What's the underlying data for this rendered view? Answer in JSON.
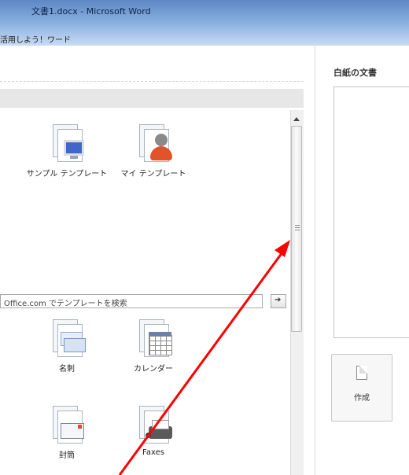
{
  "window": {
    "title": "文書1.docx - Microsoft Word",
    "subtitle": "活用しよう！ワード"
  },
  "templates": {
    "local_items": [
      {
        "label": "サンプル テンプレート",
        "icon": "computer-document-icon"
      },
      {
        "label": "マイ テンプレート",
        "icon": "user-document-icon"
      }
    ],
    "search": {
      "text": "Office.com でテンプレートを検索"
    },
    "online_items": [
      {
        "label": "名刺",
        "icon": "business-card-icon"
      },
      {
        "label": "カレンダー",
        "icon": "calendar-icon"
      },
      {
        "label": "封筒",
        "icon": "envelope-icon"
      },
      {
        "label": "Faxes",
        "icon": "fax-icon"
      }
    ]
  },
  "preview_panel": {
    "title": "白紙の文書",
    "create_label": "作成"
  },
  "annotation": {
    "color": "#ff0000"
  }
}
